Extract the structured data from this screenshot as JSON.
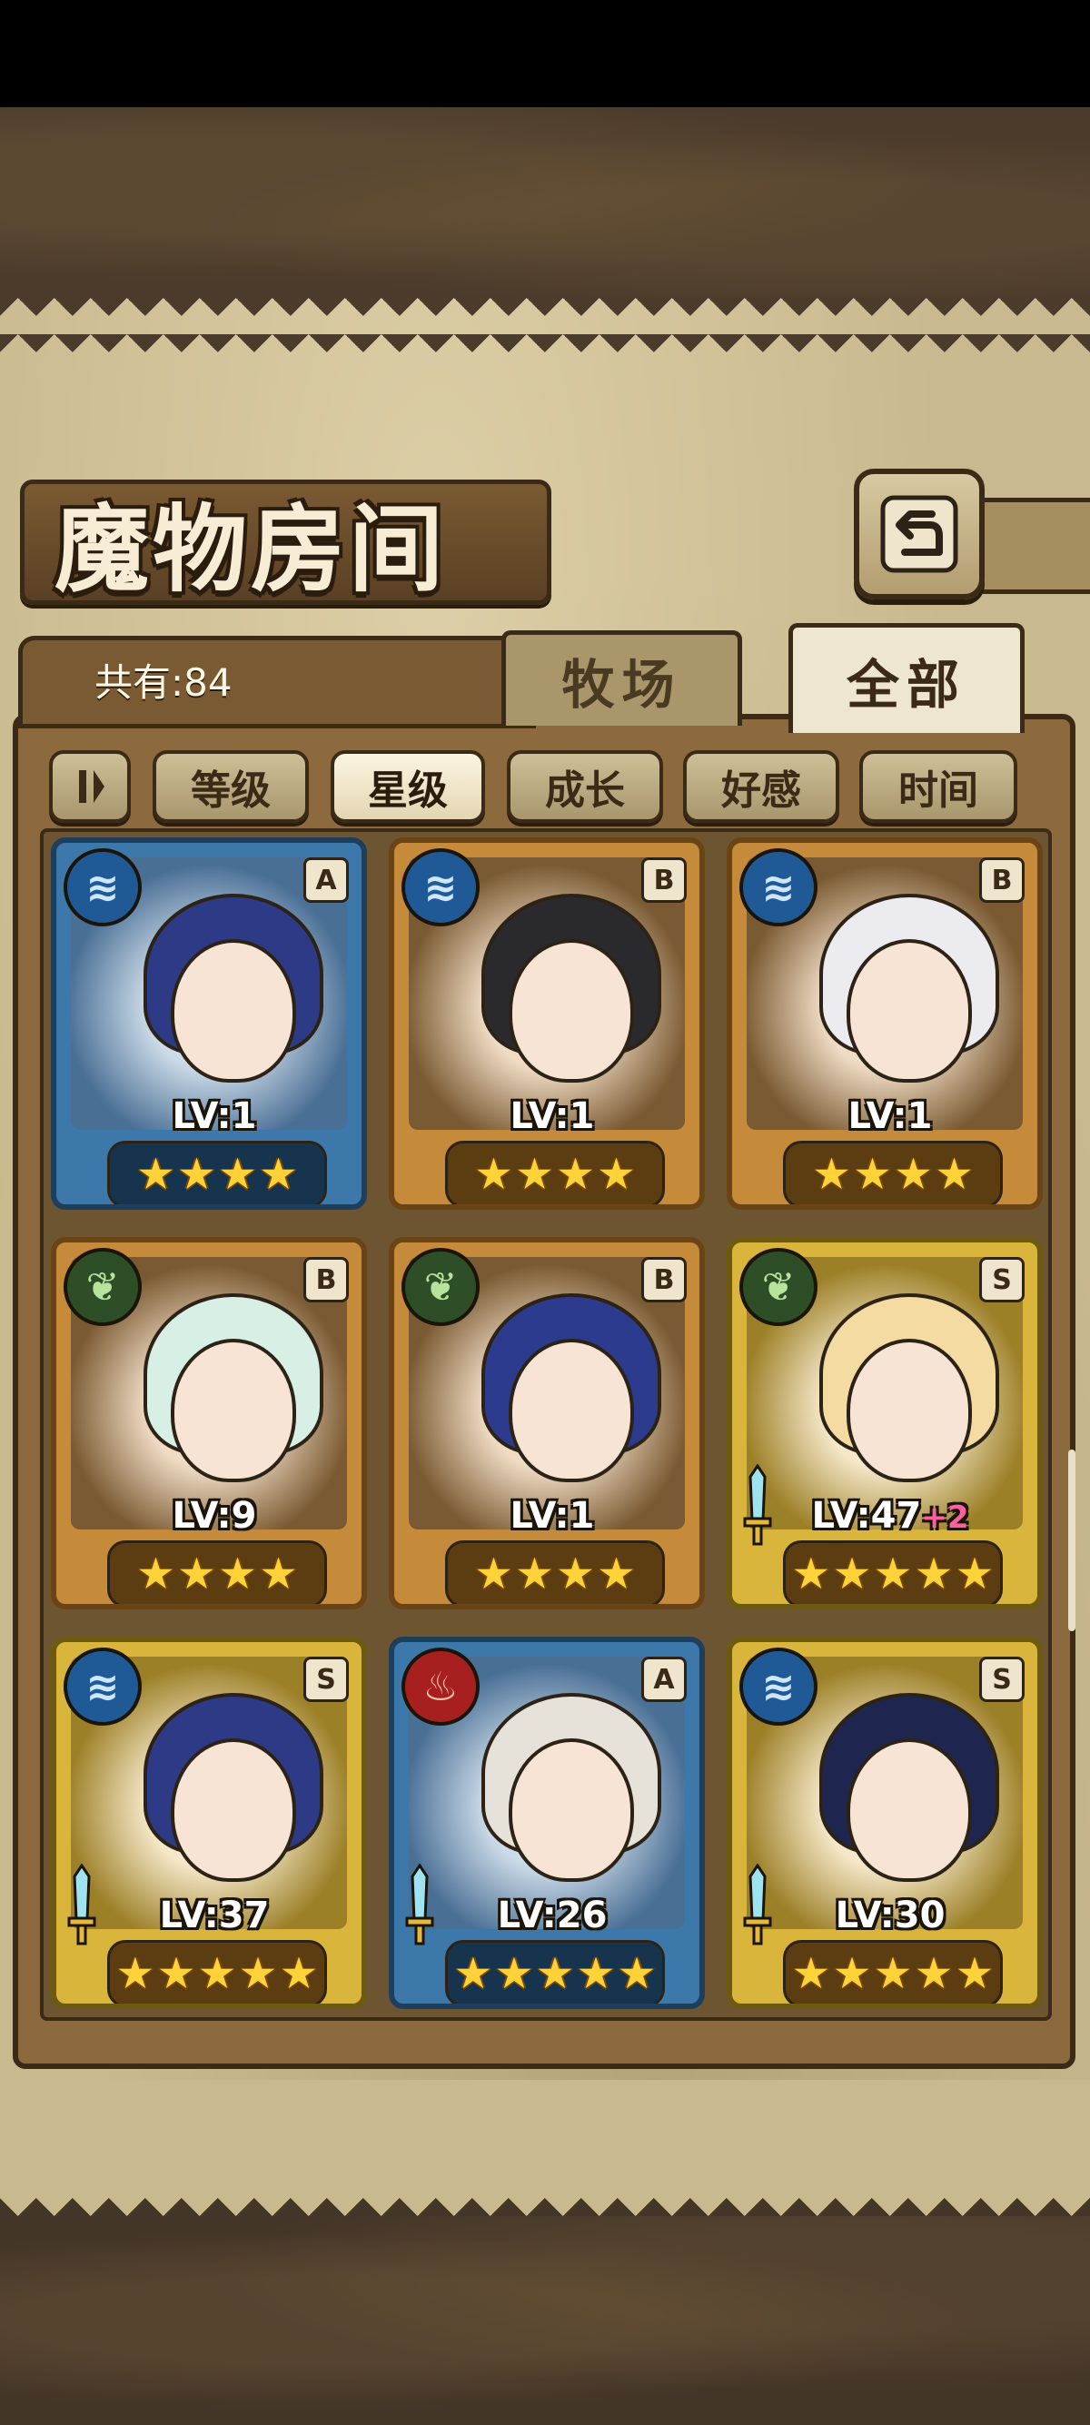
{
  "header": {
    "title": "魔物房间"
  },
  "tabs": [
    {
      "label": "牧场"
    },
    {
      "label": "全部"
    }
  ],
  "count_label": "共有:84",
  "filters": [
    "等级",
    "星级",
    "成长",
    "好感",
    "时间"
  ],
  "active_filter": "星级",
  "cards": [
    {
      "element": "water",
      "rank": "A",
      "level": "LV:1",
      "plus": "",
      "stars": 4,
      "frame": "A",
      "hair": "#2d3b86",
      "sword": false
    },
    {
      "element": "water",
      "rank": "B",
      "level": "LV:1",
      "plus": "",
      "stars": 4,
      "frame": "B",
      "hair": "#2a2a2e",
      "sword": false
    },
    {
      "element": "water",
      "rank": "B",
      "level": "LV:1",
      "plus": "",
      "stars": 4,
      "frame": "B",
      "hair": "#ecebef",
      "sword": false
    },
    {
      "element": "wood",
      "rank": "B",
      "level": "LV:9",
      "plus": "",
      "stars": 4,
      "frame": "B",
      "hair": "#d8efe6",
      "sword": false
    },
    {
      "element": "wood",
      "rank": "B",
      "level": "LV:1",
      "plus": "",
      "stars": 4,
      "frame": "B",
      "hair": "#2c3b8e",
      "sword": false
    },
    {
      "element": "wood",
      "rank": "S",
      "level": "LV:47",
      "plus": "+2",
      "stars": 5,
      "frame": "S",
      "hair": "#f4dba2",
      "sword": true
    },
    {
      "element": "water",
      "rank": "S",
      "level": "LV:37",
      "plus": "",
      "stars": 5,
      "frame": "S",
      "hair": "#2d3b86",
      "sword": true
    },
    {
      "element": "fire",
      "rank": "A",
      "level": "LV:26",
      "plus": "",
      "stars": 5,
      "frame": "A",
      "hair": "#e7e2d9",
      "sword": true
    },
    {
      "element": "water",
      "rank": "S",
      "level": "LV:30",
      "plus": "",
      "stars": 5,
      "frame": "S",
      "hair": "#1e2650",
      "sword": true
    }
  ],
  "icons": {
    "water": "water-element-icon",
    "wood": "wood-element-icon",
    "fire": "fire-element-icon",
    "back": "back-arrow-icon"
  }
}
